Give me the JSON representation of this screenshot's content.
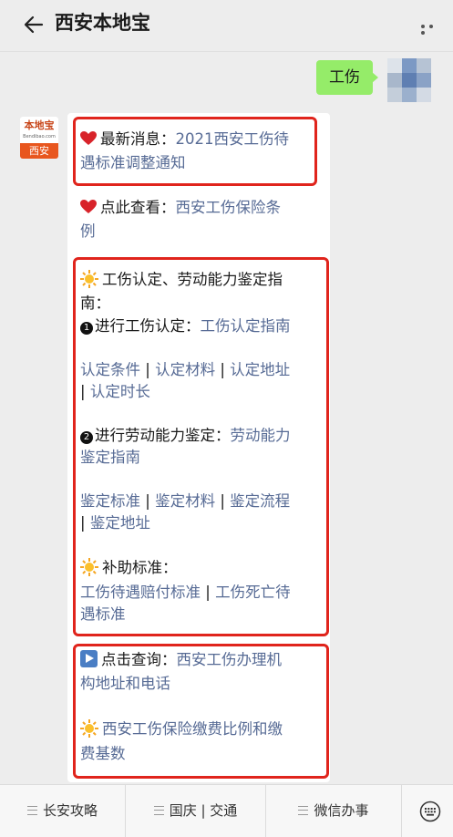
{
  "header": {
    "title": "西安本地宝",
    "back_icon": "arrow-left-icon",
    "more_icon": "more-dots-icon"
  },
  "user_message": {
    "text": "工伤"
  },
  "bot": {
    "logo_top": "本地宝",
    "logo_mid": "Bendibao.com",
    "logo_city": "西安"
  },
  "card": {
    "news_label": "最新消息：",
    "news_link_1": "2021西安工伤待",
    "news_link_2": "遇标准调整通知",
    "view_label": "点此查看：",
    "view_link_1": "西安工伤保险条",
    "view_link_2": "例",
    "guide_title_1": "工伤认定、劳动能力鉴定指",
    "guide_title_2": "南：",
    "step1_num": "1",
    "step1_label": "进行工伤认定：",
    "step1_link": "工伤认定指南",
    "s1_link_a": "认定条件",
    "s1_link_b": "认定材料",
    "s1_link_c": "认定地址",
    "s1_link_d": "认定时长",
    "separator": "|",
    "step2_num": "2",
    "step2_label": "进行劳动能力鉴定：",
    "step2_link_1": "劳动能力",
    "step2_link_2": "鉴定指南",
    "s2_link_a": "鉴定标准",
    "s2_link_b": "鉴定材料",
    "s2_link_c": "鉴定流程",
    "s2_link_d": "鉴定地址",
    "subsidy_label": "补助标准：",
    "subsidy_link_a": "工伤待遇赔付标准",
    "subsidy_link_b_1": "工伤死亡待",
    "subsidy_link_b_2": "遇标准",
    "query_label": "点击查询：",
    "query_link_1": "西安工伤办理机",
    "query_link_2": "构地址和电话",
    "fee_link_1": "西安工伤保险缴费比例和缴",
    "fee_link_2": "费基数"
  },
  "menu": {
    "items": [
      "长安攻略",
      "国庆 | 交通",
      "微信办事"
    ],
    "keyboard_icon": "keyboard-icon"
  },
  "colors": {
    "link": "#576b95",
    "highlight_border": "#e0241c",
    "user_bubble": "#95ec69",
    "background": "#ededed"
  }
}
